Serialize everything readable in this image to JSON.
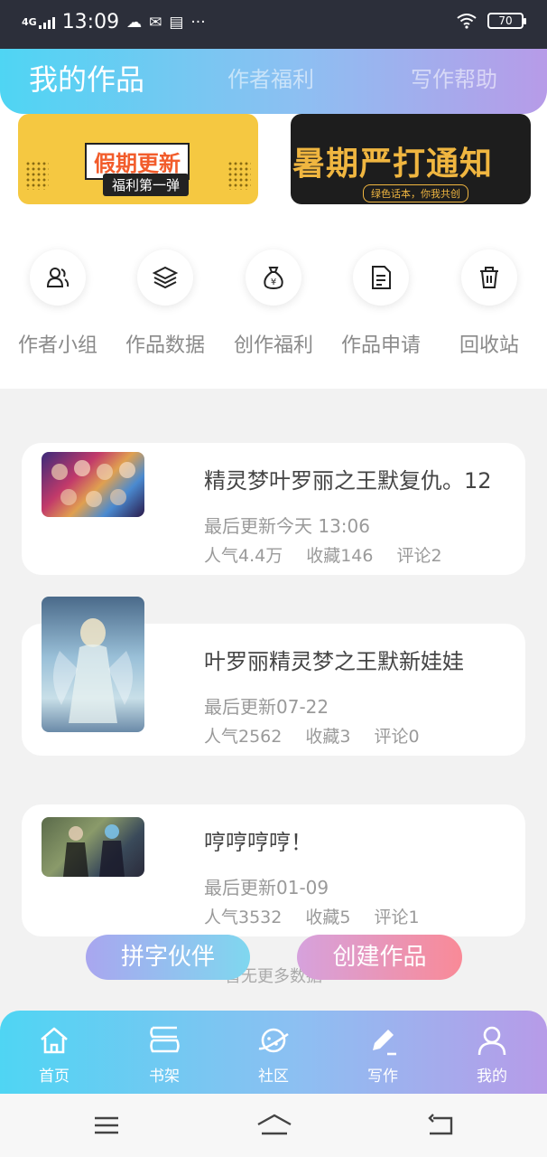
{
  "status_bar": {
    "network": "4G",
    "time": "13:09",
    "icons": [
      "cloud-icon",
      "wechat-icon",
      "calendar-icon",
      "more-dots-icon"
    ],
    "battery": "70"
  },
  "header": {
    "tabs": [
      {
        "label": "我的作品",
        "active": true
      },
      {
        "label": "作者福利",
        "active": false
      },
      {
        "label": "写作帮助",
        "active": false
      }
    ]
  },
  "banners": [
    {
      "title": "假期更新",
      "subtitle": "福利第一弹"
    },
    {
      "title": "暑期严打通知",
      "subtitle": "绿色话本，你我共创"
    }
  ],
  "features": [
    {
      "label": "作者小组",
      "icon": "group-icon"
    },
    {
      "label": "作品数据",
      "icon": "layers-icon"
    },
    {
      "label": "创作福利",
      "icon": "money-bag-icon"
    },
    {
      "label": "作品申请",
      "icon": "document-icon"
    },
    {
      "label": "回收站",
      "icon": "trash-icon"
    }
  ],
  "works": [
    {
      "title": "精灵梦叶罗丽之王默复仇。12",
      "updated": "最后更新今天 13:06",
      "popularity": "人气4.4万",
      "favorites": "收藏146",
      "comments": "评论2"
    },
    {
      "title": "叶罗丽精灵梦之王默新娃娃",
      "updated": "最后更新07-22",
      "popularity": "人气2562",
      "favorites": "收藏3",
      "comments": "评论0"
    },
    {
      "title": "哼哼哼哼！",
      "updated": "最后更新01-09",
      "popularity": "人气3532",
      "favorites": "收藏5",
      "comments": "评论1"
    }
  ],
  "no_more": "暂无更多数据",
  "fab": {
    "left": "拼字伙伴",
    "right": "创建作品"
  },
  "bottom_nav": [
    {
      "label": "首页",
      "icon": "home-icon"
    },
    {
      "label": "书架",
      "icon": "bookshelf-icon"
    },
    {
      "label": "社区",
      "icon": "planet-icon"
    },
    {
      "label": "写作",
      "icon": "pen-icon",
      "active": true
    },
    {
      "label": "我的",
      "icon": "profile-icon"
    }
  ],
  "colors": {
    "accent_start": "#4fd5f3",
    "accent_end": "#b79be8",
    "pink": "#f98a97"
  }
}
